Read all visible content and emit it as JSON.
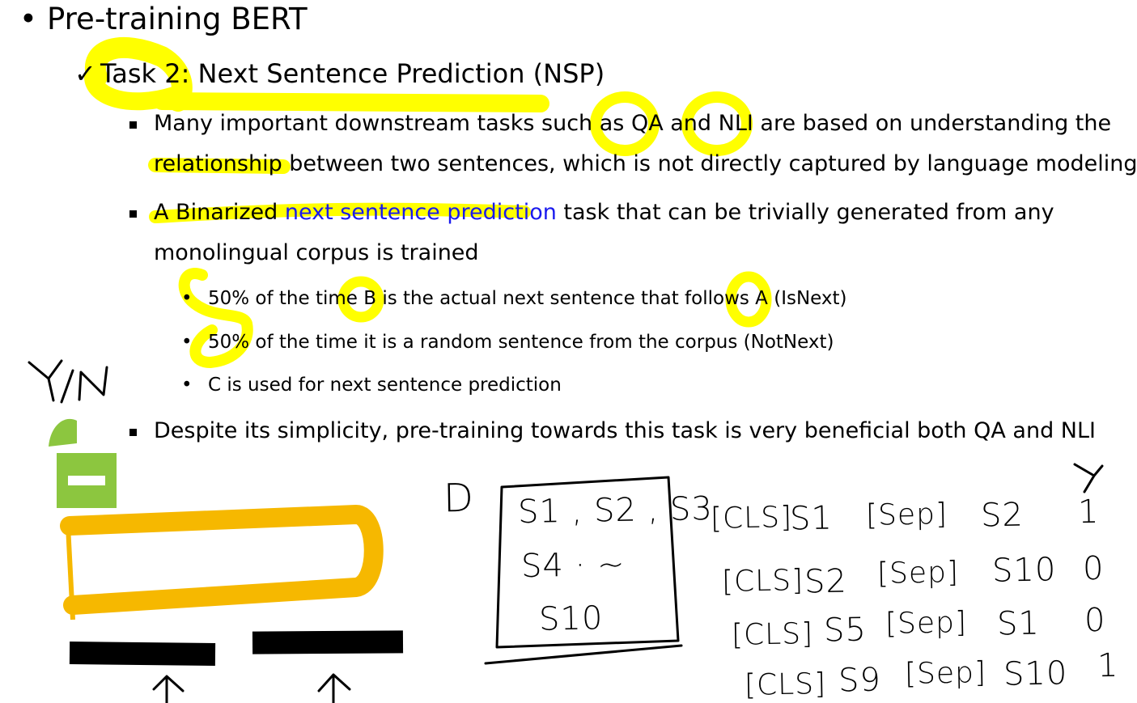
{
  "slide": {
    "title": "Pre-training BERT",
    "task_heading": "Task 2: Next Sentence Prediction (NSP)",
    "check_mark": "✓",
    "points": [
      {
        "line1": "Many important downstream tasks such as QA and NLI are based on understanding the",
        "line2": "relationship between two sentences, which is not directly captured by language modeling"
      },
      {
        "line1_a": "A Binarized ",
        "line1_b": "next sentence prediction",
        "line1_c": " task that can be trivially generated from any",
        "line2": "monolingual corpus is trained"
      },
      {
        "line1": "Despite its simplicity, pre-training towards this task is very beneficial both QA and NLI"
      }
    ],
    "sub_points": [
      "50% of the time B is the actual next sentence that follows A (IsNext)",
      "50% of the time it is a random sentence from the corpus (NotNext)",
      "C is used for next sentence prediction"
    ]
  },
  "annotations": {
    "yn_label": "Y/N",
    "corpus_label": "D",
    "corpus_lines": [
      "S1 , S2 , S3",
      "S4 · ~",
      "S10"
    ],
    "y_header": "Y",
    "pairs": [
      {
        "cls": "[CLS]",
        "a": "S1",
        "sep": "[Sep]",
        "b": "S2",
        "y": "1"
      },
      {
        "cls": "[CLS]",
        "a": "S2",
        "sep": "[Sep]",
        "b": "S10",
        "y": "0"
      },
      {
        "cls": "[CLS]",
        "a": "S5",
        "sep": "[Sep]",
        "b": "S1",
        "y": "0"
      },
      {
        "cls": "[CLS]",
        "a": "S9",
        "sep": "[Sep]",
        "b": "S10",
        "y": "1"
      }
    ]
  },
  "colors": {
    "highlighter": "#ffff00",
    "model_block": "#f6b800",
    "classifier": "#8cc63f",
    "ink": "#000000",
    "link_blue": "#1a1aee"
  }
}
